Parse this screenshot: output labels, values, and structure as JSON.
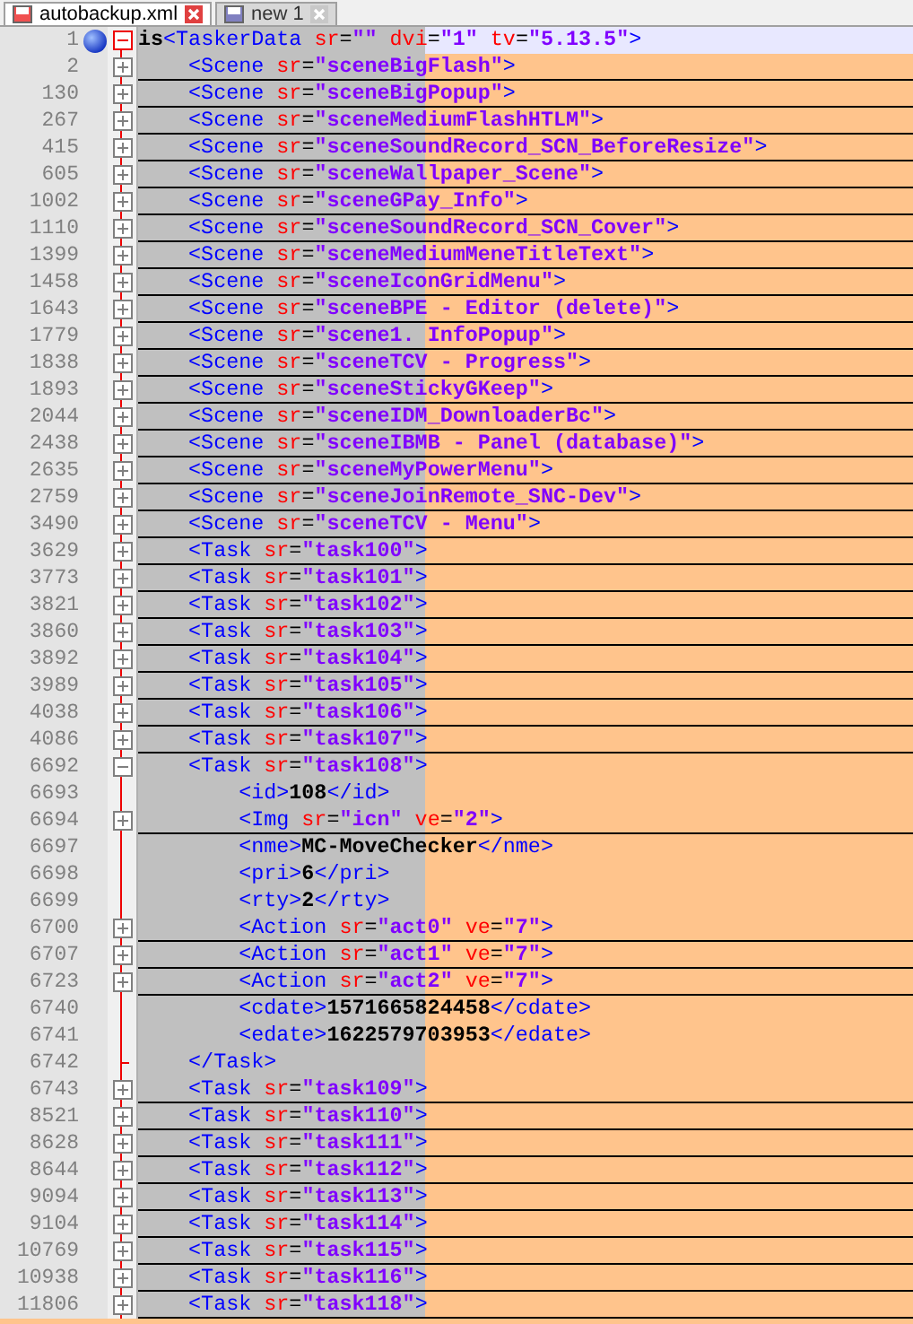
{
  "tabs": [
    {
      "label": "autobackup.xml",
      "selected": true
    },
    {
      "label": "new 1",
      "selected": false
    }
  ],
  "lines": [
    {
      "num": "1",
      "kind": "fold",
      "expanded": true,
      "bookmarked": true,
      "current": true,
      "parts": [
        {
          "kind": "text",
          "text": "is"
        },
        {
          "kind": "tag",
          "text": "<TaskerData "
        },
        {
          "kind": "attr",
          "text": "sr"
        },
        {
          "kind": "op",
          "text": "="
        },
        {
          "kind": "val",
          "text": "\"\""
        },
        {
          "kind": "attr",
          "text": " dvi"
        },
        {
          "kind": "op",
          "text": "="
        },
        {
          "kind": "val",
          "text": "\"1\""
        },
        {
          "kind": "attr",
          "text": " tv"
        },
        {
          "kind": "op",
          "text": "="
        },
        {
          "kind": "val",
          "text": "\"5.13.5\""
        },
        {
          "kind": "tag",
          "text": ">"
        }
      ],
      "children": [
        {
          "num": "2",
          "kind": "fold",
          "expanded": false,
          "parts": [
            {
              "kind": "tag",
              "text": "<Scene "
            },
            {
              "kind": "attr",
              "text": "sr"
            },
            {
              "kind": "op",
              "text": "="
            },
            {
              "kind": "val",
              "text": "\"sceneBigFlash\""
            },
            {
              "kind": "tag",
              "text": ">"
            }
          ]
        },
        {
          "num": "130",
          "kind": "fold",
          "expanded": false,
          "parts": [
            {
              "kind": "tag",
              "text": "<Scene "
            },
            {
              "kind": "attr",
              "text": "sr"
            },
            {
              "kind": "op",
              "text": "="
            },
            {
              "kind": "val",
              "text": "\"sceneBigPopup\""
            },
            {
              "kind": "tag",
              "text": ">"
            }
          ]
        },
        {
          "num": "267",
          "kind": "fold",
          "expanded": false,
          "parts": [
            {
              "kind": "tag",
              "text": "<Scene "
            },
            {
              "kind": "attr",
              "text": "sr"
            },
            {
              "kind": "op",
              "text": "="
            },
            {
              "kind": "val",
              "text": "\"sceneMediumFlashHTLM\""
            },
            {
              "kind": "tag",
              "text": ">"
            }
          ]
        },
        {
          "num": "415",
          "kind": "fold",
          "expanded": false,
          "parts": [
            {
              "kind": "tag",
              "text": "<Scene "
            },
            {
              "kind": "attr",
              "text": "sr"
            },
            {
              "kind": "op",
              "text": "="
            },
            {
              "kind": "val",
              "text": "\"sceneSoundRecord_SCN_BeforeResize\""
            },
            {
              "kind": "tag",
              "text": ">"
            }
          ]
        },
        {
          "num": "605",
          "kind": "fold",
          "expanded": false,
          "parts": [
            {
              "kind": "tag",
              "text": "<Scene "
            },
            {
              "kind": "attr",
              "text": "sr"
            },
            {
              "kind": "op",
              "text": "="
            },
            {
              "kind": "val",
              "text": "\"sceneWallpaper_Scene\""
            },
            {
              "kind": "tag",
              "text": ">"
            }
          ]
        },
        {
          "num": "1002",
          "kind": "fold",
          "expanded": false,
          "parts": [
            {
              "kind": "tag",
              "text": "<Scene "
            },
            {
              "kind": "attr",
              "text": "sr"
            },
            {
              "kind": "op",
              "text": "="
            },
            {
              "kind": "val",
              "text": "\"sceneGPay_Info\""
            },
            {
              "kind": "tag",
              "text": ">"
            }
          ]
        },
        {
          "num": "1110",
          "kind": "fold",
          "expanded": false,
          "parts": [
            {
              "kind": "tag",
              "text": "<Scene "
            },
            {
              "kind": "attr",
              "text": "sr"
            },
            {
              "kind": "op",
              "text": "="
            },
            {
              "kind": "val",
              "text": "\"sceneSoundRecord_SCN_Cover\""
            },
            {
              "kind": "tag",
              "text": ">"
            }
          ]
        },
        {
          "num": "1399",
          "kind": "fold",
          "expanded": false,
          "parts": [
            {
              "kind": "tag",
              "text": "<Scene "
            },
            {
              "kind": "attr",
              "text": "sr"
            },
            {
              "kind": "op",
              "text": "="
            },
            {
              "kind": "val",
              "text": "\"sceneMediumMeneTitleText\""
            },
            {
              "kind": "tag",
              "text": ">"
            }
          ]
        },
        {
          "num": "1458",
          "kind": "fold",
          "expanded": false,
          "parts": [
            {
              "kind": "tag",
              "text": "<Scene "
            },
            {
              "kind": "attr",
              "text": "sr"
            },
            {
              "kind": "op",
              "text": "="
            },
            {
              "kind": "val",
              "text": "\"sceneIconGridMenu\""
            },
            {
              "kind": "tag",
              "text": ">"
            }
          ]
        },
        {
          "num": "1643",
          "kind": "fold",
          "expanded": false,
          "parts": [
            {
              "kind": "tag",
              "text": "<Scene "
            },
            {
              "kind": "attr",
              "text": "sr"
            },
            {
              "kind": "op",
              "text": "="
            },
            {
              "kind": "val",
              "text": "\"sceneBPE - Editor (delete)\""
            },
            {
              "kind": "tag",
              "text": ">"
            }
          ]
        },
        {
          "num": "1779",
          "kind": "fold",
          "expanded": false,
          "parts": [
            {
              "kind": "tag",
              "text": "<Scene "
            },
            {
              "kind": "attr",
              "text": "sr"
            },
            {
              "kind": "op",
              "text": "="
            },
            {
              "kind": "val",
              "text": "\"scene1. InfoPopup\""
            },
            {
              "kind": "tag",
              "text": ">"
            }
          ]
        },
        {
          "num": "1838",
          "kind": "fold",
          "expanded": false,
          "parts": [
            {
              "kind": "tag",
              "text": "<Scene "
            },
            {
              "kind": "attr",
              "text": "sr"
            },
            {
              "kind": "op",
              "text": "="
            },
            {
              "kind": "val",
              "text": "\"sceneTCV - Progress\""
            },
            {
              "kind": "tag",
              "text": ">"
            }
          ]
        },
        {
          "num": "1893",
          "kind": "fold",
          "expanded": false,
          "parts": [
            {
              "kind": "tag",
              "text": "<Scene "
            },
            {
              "kind": "attr",
              "text": "sr"
            },
            {
              "kind": "op",
              "text": "="
            },
            {
              "kind": "val",
              "text": "\"sceneStickyGKeep\""
            },
            {
              "kind": "tag",
              "text": ">"
            }
          ]
        },
        {
          "num": "2044",
          "kind": "fold",
          "expanded": false,
          "parts": [
            {
              "kind": "tag",
              "text": "<Scene "
            },
            {
              "kind": "attr",
              "text": "sr"
            },
            {
              "kind": "op",
              "text": "="
            },
            {
              "kind": "val",
              "text": "\"sceneIDM_DownloaderBc\""
            },
            {
              "kind": "tag",
              "text": ">"
            }
          ]
        },
        {
          "num": "2438",
          "kind": "fold",
          "expanded": false,
          "parts": [
            {
              "kind": "tag",
              "text": "<Scene "
            },
            {
              "kind": "attr",
              "text": "sr"
            },
            {
              "kind": "op",
              "text": "="
            },
            {
              "kind": "val",
              "text": "\"sceneIBMB - Panel (database)\""
            },
            {
              "kind": "tag",
              "text": ">"
            }
          ]
        },
        {
          "num": "2635",
          "kind": "fold",
          "expanded": false,
          "parts": [
            {
              "kind": "tag",
              "text": "<Scene "
            },
            {
              "kind": "attr",
              "text": "sr"
            },
            {
              "kind": "op",
              "text": "="
            },
            {
              "kind": "val",
              "text": "\"sceneMyPowerMenu\""
            },
            {
              "kind": "tag",
              "text": ">"
            }
          ]
        },
        {
          "num": "2759",
          "kind": "fold",
          "expanded": false,
          "parts": [
            {
              "kind": "tag",
              "text": "<Scene "
            },
            {
              "kind": "attr",
              "text": "sr"
            },
            {
              "kind": "op",
              "text": "="
            },
            {
              "kind": "val",
              "text": "\"sceneJoinRemote_SNC-Dev\""
            },
            {
              "kind": "tag",
              "text": ">"
            }
          ]
        },
        {
          "num": "3490",
          "kind": "fold",
          "expanded": false,
          "parts": [
            {
              "kind": "tag",
              "text": "<Scene "
            },
            {
              "kind": "attr",
              "text": "sr"
            },
            {
              "kind": "op",
              "text": "="
            },
            {
              "kind": "val",
              "text": "\"sceneTCV - Menu\""
            },
            {
              "kind": "tag",
              "text": ">"
            }
          ]
        },
        {
          "num": "3629",
          "kind": "fold",
          "expanded": false,
          "parts": [
            {
              "kind": "tag",
              "text": "<Task "
            },
            {
              "kind": "attr",
              "text": "sr"
            },
            {
              "kind": "op",
              "text": "="
            },
            {
              "kind": "val",
              "text": "\"task100\""
            },
            {
              "kind": "tag",
              "text": ">"
            }
          ]
        },
        {
          "num": "3773",
          "kind": "fold",
          "expanded": false,
          "parts": [
            {
              "kind": "tag",
              "text": "<Task "
            },
            {
              "kind": "attr",
              "text": "sr"
            },
            {
              "kind": "op",
              "text": "="
            },
            {
              "kind": "val",
              "text": "\"task101\""
            },
            {
              "kind": "tag",
              "text": ">"
            }
          ]
        },
        {
          "num": "3821",
          "kind": "fold",
          "expanded": false,
          "parts": [
            {
              "kind": "tag",
              "text": "<Task "
            },
            {
              "kind": "attr",
              "text": "sr"
            },
            {
              "kind": "op",
              "text": "="
            },
            {
              "kind": "val",
              "text": "\"task102\""
            },
            {
              "kind": "tag",
              "text": ">"
            }
          ]
        },
        {
          "num": "3860",
          "kind": "fold",
          "expanded": false,
          "parts": [
            {
              "kind": "tag",
              "text": "<Task "
            },
            {
              "kind": "attr",
              "text": "sr"
            },
            {
              "kind": "op",
              "text": "="
            },
            {
              "kind": "val",
              "text": "\"task103\""
            },
            {
              "kind": "tag",
              "text": ">"
            }
          ]
        },
        {
          "num": "3892",
          "kind": "fold",
          "expanded": false,
          "parts": [
            {
              "kind": "tag",
              "text": "<Task "
            },
            {
              "kind": "attr",
              "text": "sr"
            },
            {
              "kind": "op",
              "text": "="
            },
            {
              "kind": "val",
              "text": "\"task104\""
            },
            {
              "kind": "tag",
              "text": ">"
            }
          ]
        },
        {
          "num": "3989",
          "kind": "fold",
          "expanded": false,
          "parts": [
            {
              "kind": "tag",
              "text": "<Task "
            },
            {
              "kind": "attr",
              "text": "sr"
            },
            {
              "kind": "op",
              "text": "="
            },
            {
              "kind": "val",
              "text": "\"task105\""
            },
            {
              "kind": "tag",
              "text": ">"
            }
          ]
        },
        {
          "num": "4038",
          "kind": "fold",
          "expanded": false,
          "parts": [
            {
              "kind": "tag",
              "text": "<Task "
            },
            {
              "kind": "attr",
              "text": "sr"
            },
            {
              "kind": "op",
              "text": "="
            },
            {
              "kind": "val",
              "text": "\"task106\""
            },
            {
              "kind": "tag",
              "text": ">"
            }
          ]
        },
        {
          "num": "4086",
          "kind": "fold",
          "expanded": false,
          "parts": [
            {
              "kind": "tag",
              "text": "<Task "
            },
            {
              "kind": "attr",
              "text": "sr"
            },
            {
              "kind": "op",
              "text": "="
            },
            {
              "kind": "val",
              "text": "\"task107\""
            },
            {
              "kind": "tag",
              "text": ">"
            }
          ]
        },
        {
          "num": "6692",
          "kind": "fold",
          "expanded": true,
          "parts": [
            {
              "kind": "tag",
              "text": "<Task "
            },
            {
              "kind": "attr",
              "text": "sr"
            },
            {
              "kind": "op",
              "text": "="
            },
            {
              "kind": "val",
              "text": "\"task108\""
            },
            {
              "kind": "tag",
              "text": ">"
            }
          ],
          "children": [
            {
              "num": "6693",
              "kind": "leaf",
              "parts": [
                {
                  "kind": "tag",
                  "text": "<id>"
                },
                {
                  "kind": "text",
                  "text": "108"
                },
                {
                  "kind": "tag",
                  "text": "</id>"
                }
              ]
            },
            {
              "num": "6694",
              "kind": "fold",
              "expanded": false,
              "parts": [
                {
                  "kind": "tag",
                  "text": "<Img "
                },
                {
                  "kind": "attr",
                  "text": "sr"
                },
                {
                  "kind": "op",
                  "text": "="
                },
                {
                  "kind": "val",
                  "text": "\"icn\""
                },
                {
                  "kind": "attr",
                  "text": " ve"
                },
                {
                  "kind": "op",
                  "text": "="
                },
                {
                  "kind": "val",
                  "text": "\"2\""
                },
                {
                  "kind": "tag",
                  "text": ">"
                }
              ]
            },
            {
              "num": "6697",
              "kind": "leaf",
              "parts": [
                {
                  "kind": "tag",
                  "text": "<nme>"
                },
                {
                  "kind": "text",
                  "text": "MC-MoveChecker"
                },
                {
                  "kind": "tag",
                  "text": "</nme>"
                }
              ]
            },
            {
              "num": "6698",
              "kind": "leaf",
              "parts": [
                {
                  "kind": "tag",
                  "text": "<pri>"
                },
                {
                  "kind": "text",
                  "text": "6"
                },
                {
                  "kind": "tag",
                  "text": "</pri>"
                }
              ]
            },
            {
              "num": "6699",
              "kind": "leaf",
              "parts": [
                {
                  "kind": "tag",
                  "text": "<rty>"
                },
                {
                  "kind": "text",
                  "text": "2"
                },
                {
                  "kind": "tag",
                  "text": "</rty>"
                }
              ]
            },
            {
              "num": "6700",
              "kind": "fold",
              "expanded": false,
              "parts": [
                {
                  "kind": "tag",
                  "text": "<Action "
                },
                {
                  "kind": "attr",
                  "text": "sr"
                },
                {
                  "kind": "op",
                  "text": "="
                },
                {
                  "kind": "val",
                  "text": "\"act0\""
                },
                {
                  "kind": "attr",
                  "text": " ve"
                },
                {
                  "kind": "op",
                  "text": "="
                },
                {
                  "kind": "val",
                  "text": "\"7\""
                },
                {
                  "kind": "tag",
                  "text": ">"
                }
              ]
            },
            {
              "num": "6707",
              "kind": "fold",
              "expanded": false,
              "parts": [
                {
                  "kind": "tag",
                  "text": "<Action "
                },
                {
                  "kind": "attr",
                  "text": "sr"
                },
                {
                  "kind": "op",
                  "text": "="
                },
                {
                  "kind": "val",
                  "text": "\"act1\""
                },
                {
                  "kind": "attr",
                  "text": " ve"
                },
                {
                  "kind": "op",
                  "text": "="
                },
                {
                  "kind": "val",
                  "text": "\"7\""
                },
                {
                  "kind": "tag",
                  "text": ">"
                }
              ]
            },
            {
              "num": "6723",
              "kind": "fold",
              "expanded": false,
              "parts": [
                {
                  "kind": "tag",
                  "text": "<Action "
                },
                {
                  "kind": "attr",
                  "text": "sr"
                },
                {
                  "kind": "op",
                  "text": "="
                },
                {
                  "kind": "val",
                  "text": "\"act2\""
                },
                {
                  "kind": "attr",
                  "text": " ve"
                },
                {
                  "kind": "op",
                  "text": "="
                },
                {
                  "kind": "val",
                  "text": "\"7\""
                },
                {
                  "kind": "tag",
                  "text": ">"
                }
              ]
            },
            {
              "num": "6740",
              "kind": "leaf",
              "parts": [
                {
                  "kind": "tag",
                  "text": "<cdate>"
                },
                {
                  "kind": "text",
                  "text": "1571665824458"
                },
                {
                  "kind": "tag",
                  "text": "</cdate>"
                }
              ]
            },
            {
              "num": "6741",
              "kind": "leaf",
              "parts": [
                {
                  "kind": "tag",
                  "text": "<edate>"
                },
                {
                  "kind": "text",
                  "text": "1622579703953"
                },
                {
                  "kind": "tag",
                  "text": "</edate>"
                }
              ]
            },
            {
              "num": "6742",
              "kind": "close",
              "parts": [
                {
                  "kind": "tag",
                  "text": "</Task>"
                }
              ]
            }
          ]
        },
        {
          "num": "6743",
          "kind": "fold",
          "expanded": false,
          "parts": [
            {
              "kind": "tag",
              "text": "<Task "
            },
            {
              "kind": "attr",
              "text": "sr"
            },
            {
              "kind": "op",
              "text": "="
            },
            {
              "kind": "val",
              "text": "\"task109\""
            },
            {
              "kind": "tag",
              "text": ">"
            }
          ]
        },
        {
          "num": "8521",
          "kind": "fold",
          "expanded": false,
          "parts": [
            {
              "kind": "tag",
              "text": "<Task "
            },
            {
              "kind": "attr",
              "text": "sr"
            },
            {
              "kind": "op",
              "text": "="
            },
            {
              "kind": "val",
              "text": "\"task110\""
            },
            {
              "kind": "tag",
              "text": ">"
            }
          ]
        },
        {
          "num": "8628",
          "kind": "fold",
          "expanded": false,
          "parts": [
            {
              "kind": "tag",
              "text": "<Task "
            },
            {
              "kind": "attr",
              "text": "sr"
            },
            {
              "kind": "op",
              "text": "="
            },
            {
              "kind": "val",
              "text": "\"task111\""
            },
            {
              "kind": "tag",
              "text": ">"
            }
          ]
        },
        {
          "num": "8644",
          "kind": "fold",
          "expanded": false,
          "parts": [
            {
              "kind": "tag",
              "text": "<Task "
            },
            {
              "kind": "attr",
              "text": "sr"
            },
            {
              "kind": "op",
              "text": "="
            },
            {
              "kind": "val",
              "text": "\"task112\""
            },
            {
              "kind": "tag",
              "text": ">"
            }
          ]
        },
        {
          "num": "9094",
          "kind": "fold",
          "expanded": false,
          "parts": [
            {
              "kind": "tag",
              "text": "<Task "
            },
            {
              "kind": "attr",
              "text": "sr"
            },
            {
              "kind": "op",
              "text": "="
            },
            {
              "kind": "val",
              "text": "\"task113\""
            },
            {
              "kind": "tag",
              "text": ">"
            }
          ]
        },
        {
          "num": "9104",
          "kind": "fold",
          "expanded": false,
          "parts": [
            {
              "kind": "tag",
              "text": "<Task "
            },
            {
              "kind": "attr",
              "text": "sr"
            },
            {
              "kind": "op",
              "text": "="
            },
            {
              "kind": "val",
              "text": "\"task114\""
            },
            {
              "kind": "tag",
              "text": ">"
            }
          ]
        },
        {
          "num": "10769",
          "kind": "fold",
          "expanded": false,
          "parts": [
            {
              "kind": "tag",
              "text": "<Task "
            },
            {
              "kind": "attr",
              "text": "sr"
            },
            {
              "kind": "op",
              "text": "="
            },
            {
              "kind": "val",
              "text": "\"task115\""
            },
            {
              "kind": "tag",
              "text": ">"
            }
          ]
        },
        {
          "num": "10938",
          "kind": "fold",
          "expanded": false,
          "parts": [
            {
              "kind": "tag",
              "text": "<Task "
            },
            {
              "kind": "attr",
              "text": "sr"
            },
            {
              "kind": "op",
              "text": "="
            },
            {
              "kind": "val",
              "text": "\"task116\""
            },
            {
              "kind": "tag",
              "text": ">"
            }
          ]
        },
        {
          "num": "11806",
          "kind": "fold",
          "expanded": false,
          "parts": [
            {
              "kind": "tag",
              "text": "<Task "
            },
            {
              "kind": "attr",
              "text": "sr"
            },
            {
              "kind": "op",
              "text": "="
            },
            {
              "kind": "val",
              "text": "\"task118\""
            },
            {
              "kind": "tag",
              "text": ">"
            }
          ]
        }
      ]
    }
  ]
}
